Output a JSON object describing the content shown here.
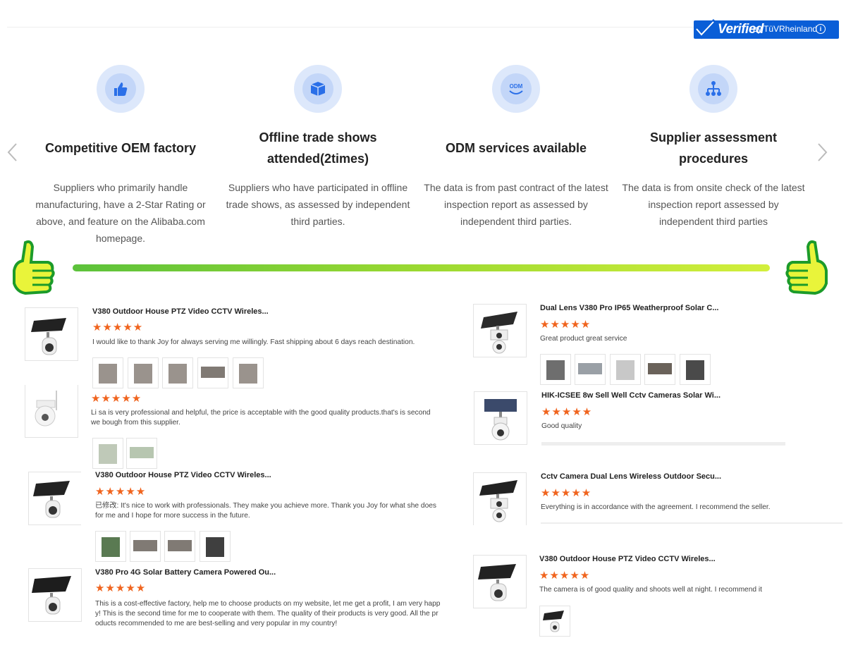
{
  "badge": {
    "verified": "Verified",
    "by": "by",
    "org": "TüVRheinland",
    "info": "i"
  },
  "features": [
    {
      "icon": "thumbs-up-icon",
      "title": "Competitive OEM factory",
      "desc": "Suppliers who primarily handle manufacturing, have a 2-Star Rating or above, and feature on the Alibaba.com homepage."
    },
    {
      "icon": "box-icon",
      "title": "Offline trade shows attended(2times)",
      "desc": "Suppliers who have participated in offline trade shows, as assessed by independent third parties."
    },
    {
      "icon": "odm-icon",
      "title": "ODM services available",
      "desc": "The data is from past contract of the latest inspection report as assessed by independent third parties."
    },
    {
      "icon": "hierarchy-icon",
      "title": "Supplier assessment procedures",
      "desc": "The data is from onsite check of the latest inspection report assessed by independent third parties"
    }
  ],
  "odm_icon_text": "ODM",
  "rating_stars": "★★★★★",
  "reviews_left": [
    {
      "title": "V380 Outdoor House PTZ Video CCTV Wireles...",
      "text": "I would like to thank Joy for always serving me willingly. Fast shipping about 6 days reach destination.",
      "photos": 5,
      "rating": 5
    },
    {
      "title": "",
      "text": "Li sa is very professional and helpful, the price is acceptable with the good quality products.that's is second we bough from this supplier.",
      "photos": 2,
      "rating": 5
    },
    {
      "title": "V380 Outdoor House PTZ Video CCTV Wireles...",
      "text": "已修改: It's nice to work with professionals. They make you achieve more. Thank you Joy for what she does for me and I hope for more success in the future.",
      "photos": 4,
      "rating": 5
    },
    {
      "title": "V380 Pro 4G Solar Battery Camera Powered Ou...",
      "text": "This is a cost-effective factory, help me to choose products on my website, let me get a profit, I am very happy! This is the second time for me to cooperate with them. The quality of their products is very good. All the products recommended to me are best-selling and very popular in my country!",
      "photos": 0,
      "rating": 5
    }
  ],
  "reviews_right": [
    {
      "title": "Dual Lens V380 Pro IP65 Weatherproof Solar C...",
      "text": "Great product great service",
      "photos": 5,
      "rating": 5
    },
    {
      "title": "HIK-ICSEE 8w Sell Well Cctv Cameras Solar Wi...",
      "text": "Good quality",
      "photos": 0,
      "rating": 5
    },
    {
      "title": "Cctv Camera Dual Lens Wireless Outdoor Secu...",
      "text": "Everything is in accordance with the agreement. I recommend the seller.",
      "photos": 0,
      "rating": 5
    },
    {
      "title": "V380 Outdoor House PTZ Video CCTV Wireles...",
      "text": "The camera is of good quality and shoots well at night. I recommend it",
      "photos": 1,
      "rating": 5
    }
  ],
  "colors": {
    "accent_blue": "#0a5ed7",
    "star_orange": "#f0641e",
    "bar_start": "#5cc23b",
    "bar_end": "#d3ef3c"
  }
}
